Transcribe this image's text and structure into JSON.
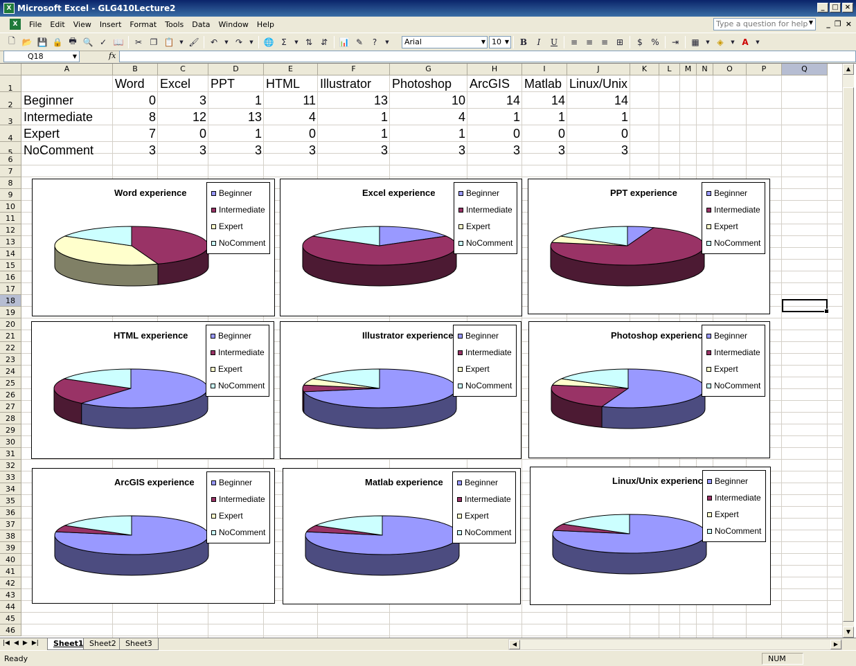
{
  "window": {
    "title": "Microsoft Excel - GLG410Lecture2",
    "app_icon": "excel-icon"
  },
  "menu": {
    "items": [
      "File",
      "Edit",
      "View",
      "Insert",
      "Format",
      "Tools",
      "Data",
      "Window",
      "Help"
    ],
    "help_placeholder": "Type a question for help"
  },
  "toolbar": {
    "font_name": "Arial",
    "font_size": "10",
    "bold": "B",
    "italic": "I",
    "underline": "U",
    "currency": "$",
    "percent": "%",
    "sum": "Σ",
    "font_color": "A"
  },
  "formula_bar": {
    "cell_ref": "Q18",
    "fx": "fx",
    "value": ""
  },
  "grid": {
    "columns": [
      "A",
      "B",
      "C",
      "D",
      "E",
      "F",
      "G",
      "H",
      "I",
      "J",
      "K",
      "L",
      "M",
      "N",
      "O",
      "P",
      "Q"
    ],
    "selected_column": "Q",
    "selected_row": 18,
    "row_count": 46,
    "header_row": [
      "Word",
      "Excel",
      "PPT",
      "HTML",
      "Illustrator",
      "Photoshop",
      "ArcGIS",
      "Matlab",
      "Linux/Unix"
    ],
    "rows": [
      {
        "label": "Beginner",
        "values": [
          0,
          3,
          1,
          11,
          13,
          10,
          14,
          14,
          14
        ]
      },
      {
        "label": "Intermediate",
        "values": [
          8,
          12,
          13,
          4,
          1,
          4,
          1,
          1,
          1
        ]
      },
      {
        "label": "Expert",
        "values": [
          7,
          0,
          1,
          0,
          1,
          1,
          0,
          0,
          0
        ]
      },
      {
        "label": "NoComment",
        "values": [
          3,
          3,
          3,
          3,
          3,
          3,
          3,
          3,
          3
        ]
      }
    ]
  },
  "chart_data": [
    {
      "type": "pie",
      "title": "Word experience",
      "categories": [
        "Beginner",
        "Intermediate",
        "Expert",
        "NoComment"
      ],
      "values": [
        0,
        8,
        7,
        3
      ],
      "legend": "right"
    },
    {
      "type": "pie",
      "title": "Excel experience",
      "categories": [
        "Beginner",
        "Intermediate",
        "Expert",
        "NoComment"
      ],
      "values": [
        3,
        12,
        0,
        3
      ],
      "legend": "right"
    },
    {
      "type": "pie",
      "title": "PPT experience",
      "categories": [
        "Beginner",
        "Intermediate",
        "Expert",
        "NoComment"
      ],
      "values": [
        1,
        13,
        1,
        3
      ],
      "legend": "right"
    },
    {
      "type": "pie",
      "title": "HTML experience",
      "categories": [
        "Beginner",
        "Intermediate",
        "Expert",
        "NoComment"
      ],
      "values": [
        11,
        4,
        0,
        3
      ],
      "legend": "right"
    },
    {
      "type": "pie",
      "title": "Illustrator experience",
      "categories": [
        "Beginner",
        "Intermediate",
        "Expert",
        "NoComment"
      ],
      "values": [
        13,
        1,
        1,
        3
      ],
      "legend": "right"
    },
    {
      "type": "pie",
      "title": "Photoshop  experience",
      "categories": [
        "Beginner",
        "Intermediate",
        "Expert",
        "NoComment"
      ],
      "values": [
        10,
        4,
        1,
        3
      ],
      "legend": "right"
    },
    {
      "type": "pie",
      "title": "ArcGIS experience",
      "categories": [
        "Beginner",
        "Intermediate",
        "Expert",
        "NoComment"
      ],
      "values": [
        14,
        1,
        0,
        3
      ],
      "legend": "right"
    },
    {
      "type": "pie",
      "title": "Matlab experience",
      "categories": [
        "Beginner",
        "Intermediate",
        "Expert",
        "NoComment"
      ],
      "values": [
        14,
        1,
        0,
        3
      ],
      "legend": "right"
    },
    {
      "type": "pie",
      "title": "Linux/Unix experience",
      "categories": [
        "Beginner",
        "Intermediate",
        "Expert",
        "NoComment"
      ],
      "values": [
        14,
        1,
        0,
        3
      ],
      "legend": "right"
    }
  ],
  "colors": {
    "Beginner": "#9999ff",
    "Intermediate": "#993366",
    "Expert": "#ffffcc",
    "NoComment": "#ccffff",
    "Beginner_side": "#4c4c80",
    "Intermediate_side": "#4c1a33",
    "Expert_side": "#808066",
    "NoComment_side": "#668080"
  },
  "sheets": {
    "tabs": [
      "Sheet1",
      "Sheet2",
      "Sheet3"
    ],
    "active": "Sheet1"
  },
  "status": {
    "text": "Ready",
    "num": "NUM"
  }
}
